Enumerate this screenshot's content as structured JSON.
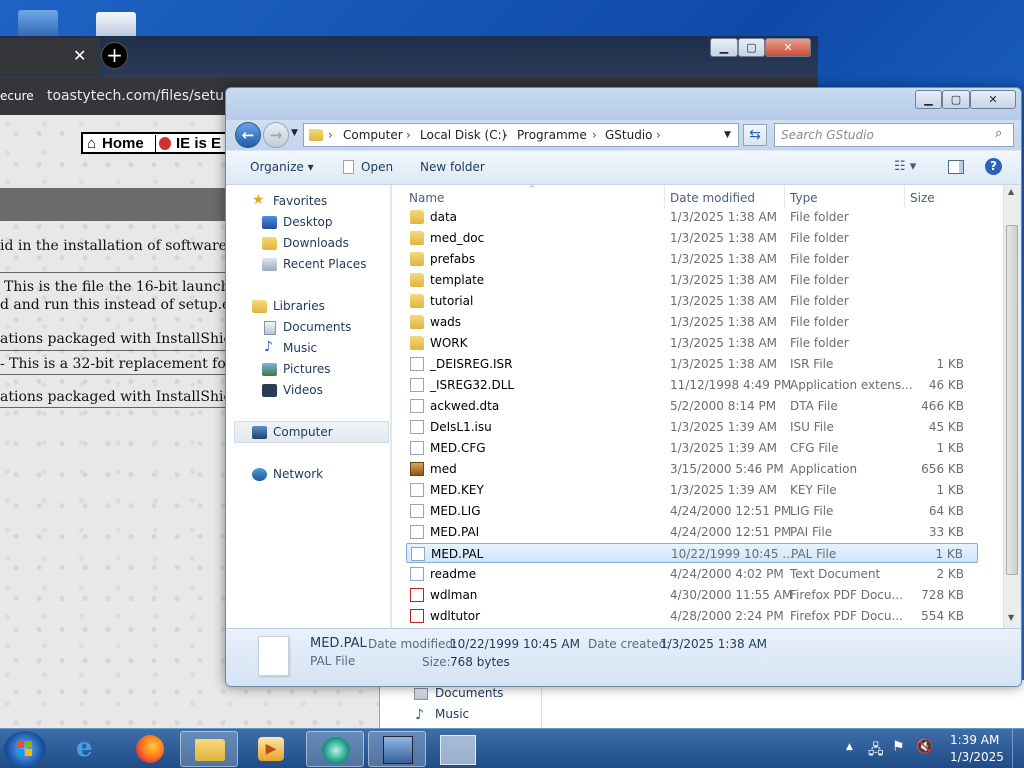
{
  "browser": {
    "url_prefix": "ecure",
    "url": "toastytech.com/files/setup.ht",
    "nav_home": "Home",
    "nav_ie": "IE is E",
    "lines": [
      "id in the installation of software wi",
      "This is the file the 16-bit launcher",
      "d and run this instead of setup.exe.",
      "ations packaged with InstallShield 3",
      "- This is a 32-bit replacement for th",
      "ations packaged with InstallShield 5"
    ]
  },
  "explorer": {
    "breadcrumb": [
      "Computer",
      "Local Disk (C:)",
      "Programme",
      "GStudio"
    ],
    "search_placeholder": "Search GStudio",
    "toolbar": {
      "organize": "Organize",
      "open": "Open",
      "new_folder": "New folder"
    },
    "nav": {
      "favorites": "Favorites",
      "desktop": "Desktop",
      "downloads": "Downloads",
      "recent_places": "Recent Places",
      "libraries": "Libraries",
      "documents": "Documents",
      "music": "Music",
      "pictures": "Pictures",
      "videos": "Videos",
      "computer": "Computer",
      "network": "Network"
    },
    "columns": {
      "name": "Name",
      "date": "Date modified",
      "type": "Type",
      "size": "Size"
    },
    "files": [
      {
        "name": "data",
        "date": "1/3/2025 1:38 AM",
        "type": "File folder",
        "size": "",
        "icon": "folder-icon"
      },
      {
        "name": "med_doc",
        "date": "1/3/2025 1:38 AM",
        "type": "File folder",
        "size": "",
        "icon": "folder-icon"
      },
      {
        "name": "prefabs",
        "date": "1/3/2025 1:38 AM",
        "type": "File folder",
        "size": "",
        "icon": "folder-icon"
      },
      {
        "name": "template",
        "date": "1/3/2025 1:38 AM",
        "type": "File folder",
        "size": "",
        "icon": "folder-icon"
      },
      {
        "name": "tutorial",
        "date": "1/3/2025 1:38 AM",
        "type": "File folder",
        "size": "",
        "icon": "folder-icon"
      },
      {
        "name": "wads",
        "date": "1/3/2025 1:38 AM",
        "type": "File folder",
        "size": "",
        "icon": "folder-icon"
      },
      {
        "name": "WORK",
        "date": "1/3/2025 1:38 AM",
        "type": "File folder",
        "size": "",
        "icon": "folder-icon"
      },
      {
        "name": "_DEISREG.ISR",
        "date": "1/3/2025 1:38 AM",
        "type": "ISR File",
        "size": "1 KB",
        "icon": "file-icon"
      },
      {
        "name": "_ISREG32.DLL",
        "date": "11/12/1998 4:49 PM",
        "type": "Application extens...",
        "size": "46 KB",
        "icon": "dll-icon"
      },
      {
        "name": "ackwed.dta",
        "date": "5/2/2000 8:14 PM",
        "type": "DTA File",
        "size": "466 KB",
        "icon": "file-icon"
      },
      {
        "name": "DeIsL1.isu",
        "date": "1/3/2025 1:39 AM",
        "type": "ISU File",
        "size": "45 KB",
        "icon": "file-icon"
      },
      {
        "name": "MED.CFG",
        "date": "1/3/2025 1:39 AM",
        "type": "CFG File",
        "size": "1 KB",
        "icon": "file-icon"
      },
      {
        "name": "med",
        "date": "3/15/2000 5:46 PM",
        "type": "Application",
        "size": "656 KB",
        "icon": "application-icon"
      },
      {
        "name": "MED.KEY",
        "date": "1/3/2025 1:39 AM",
        "type": "KEY File",
        "size": "1 KB",
        "icon": "file-icon"
      },
      {
        "name": "MED.LIG",
        "date": "4/24/2000 12:51 PM",
        "type": "LIG File",
        "size": "64 KB",
        "icon": "file-icon"
      },
      {
        "name": "MED.PAI",
        "date": "4/24/2000 12:51 PM",
        "type": "PAI File",
        "size": "33 KB",
        "icon": "file-icon"
      },
      {
        "name": "MED.PAL",
        "date": "10/22/1999 10:45 ...",
        "type": "PAL File",
        "size": "1 KB",
        "icon": "file-icon",
        "selected": true
      },
      {
        "name": "readme",
        "date": "4/24/2000 4:02 PM",
        "type": "Text Document",
        "size": "2 KB",
        "icon": "text-file-icon"
      },
      {
        "name": "wdlman",
        "date": "4/30/2000 11:55 AM",
        "type": "Firefox PDF Docu...",
        "size": "728 KB",
        "icon": "pdf-icon"
      },
      {
        "name": "wdltutor",
        "date": "4/28/2000 2:24 PM",
        "type": "Firefox PDF Docu...",
        "size": "554 KB",
        "icon": "pdf-icon"
      }
    ],
    "details": {
      "name": "MED.PAL",
      "type": "PAL File",
      "date_modified_label": "Date modified:",
      "date_modified": "10/22/1999 10:45 AM",
      "date_created_label": "Date created:",
      "date_created": "1/3/2025 1:38 AM",
      "size_label": "Size:",
      "size": "768 bytes"
    }
  },
  "window2": {
    "documents": "Documents",
    "music": "Music"
  },
  "taskbar": {
    "time": "1:39 AM",
    "date": "1/3/2025"
  }
}
